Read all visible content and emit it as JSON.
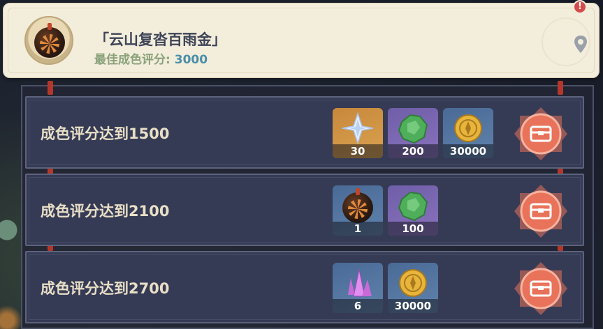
{
  "header": {
    "title": "「云山复沓百雨金」",
    "best_score_label": "最佳成色评分:",
    "best_score_value": "3000",
    "alert_glyph": "!"
  },
  "rows": [
    {
      "label": "成色评分达到1500",
      "rewards": [
        {
          "icon": "primogem-icon",
          "qty": "30"
        },
        {
          "icon": "jade-ore-icon",
          "qty": "200"
        },
        {
          "icon": "mora-coin-icon",
          "qty": "30000"
        }
      ]
    },
    {
      "label": "成色评分达到2100",
      "rewards": [
        {
          "icon": "firework-bomb-icon",
          "qty": "1"
        },
        {
          "icon": "jade-ore-icon",
          "qty": "100"
        }
      ]
    },
    {
      "label": "成色评分达到2700",
      "rewards": [
        {
          "icon": "crystal-icon",
          "qty": "6"
        },
        {
          "icon": "mora-coin-icon",
          "qty": "30000"
        }
      ]
    }
  ],
  "colors": {
    "header_bg": "#f3eddc",
    "title": "#3d4456",
    "score_label": "#8aa27a",
    "score_value": "#4a8fa8",
    "row_bg": "#363b55",
    "claim_orange": "#e8735a"
  }
}
